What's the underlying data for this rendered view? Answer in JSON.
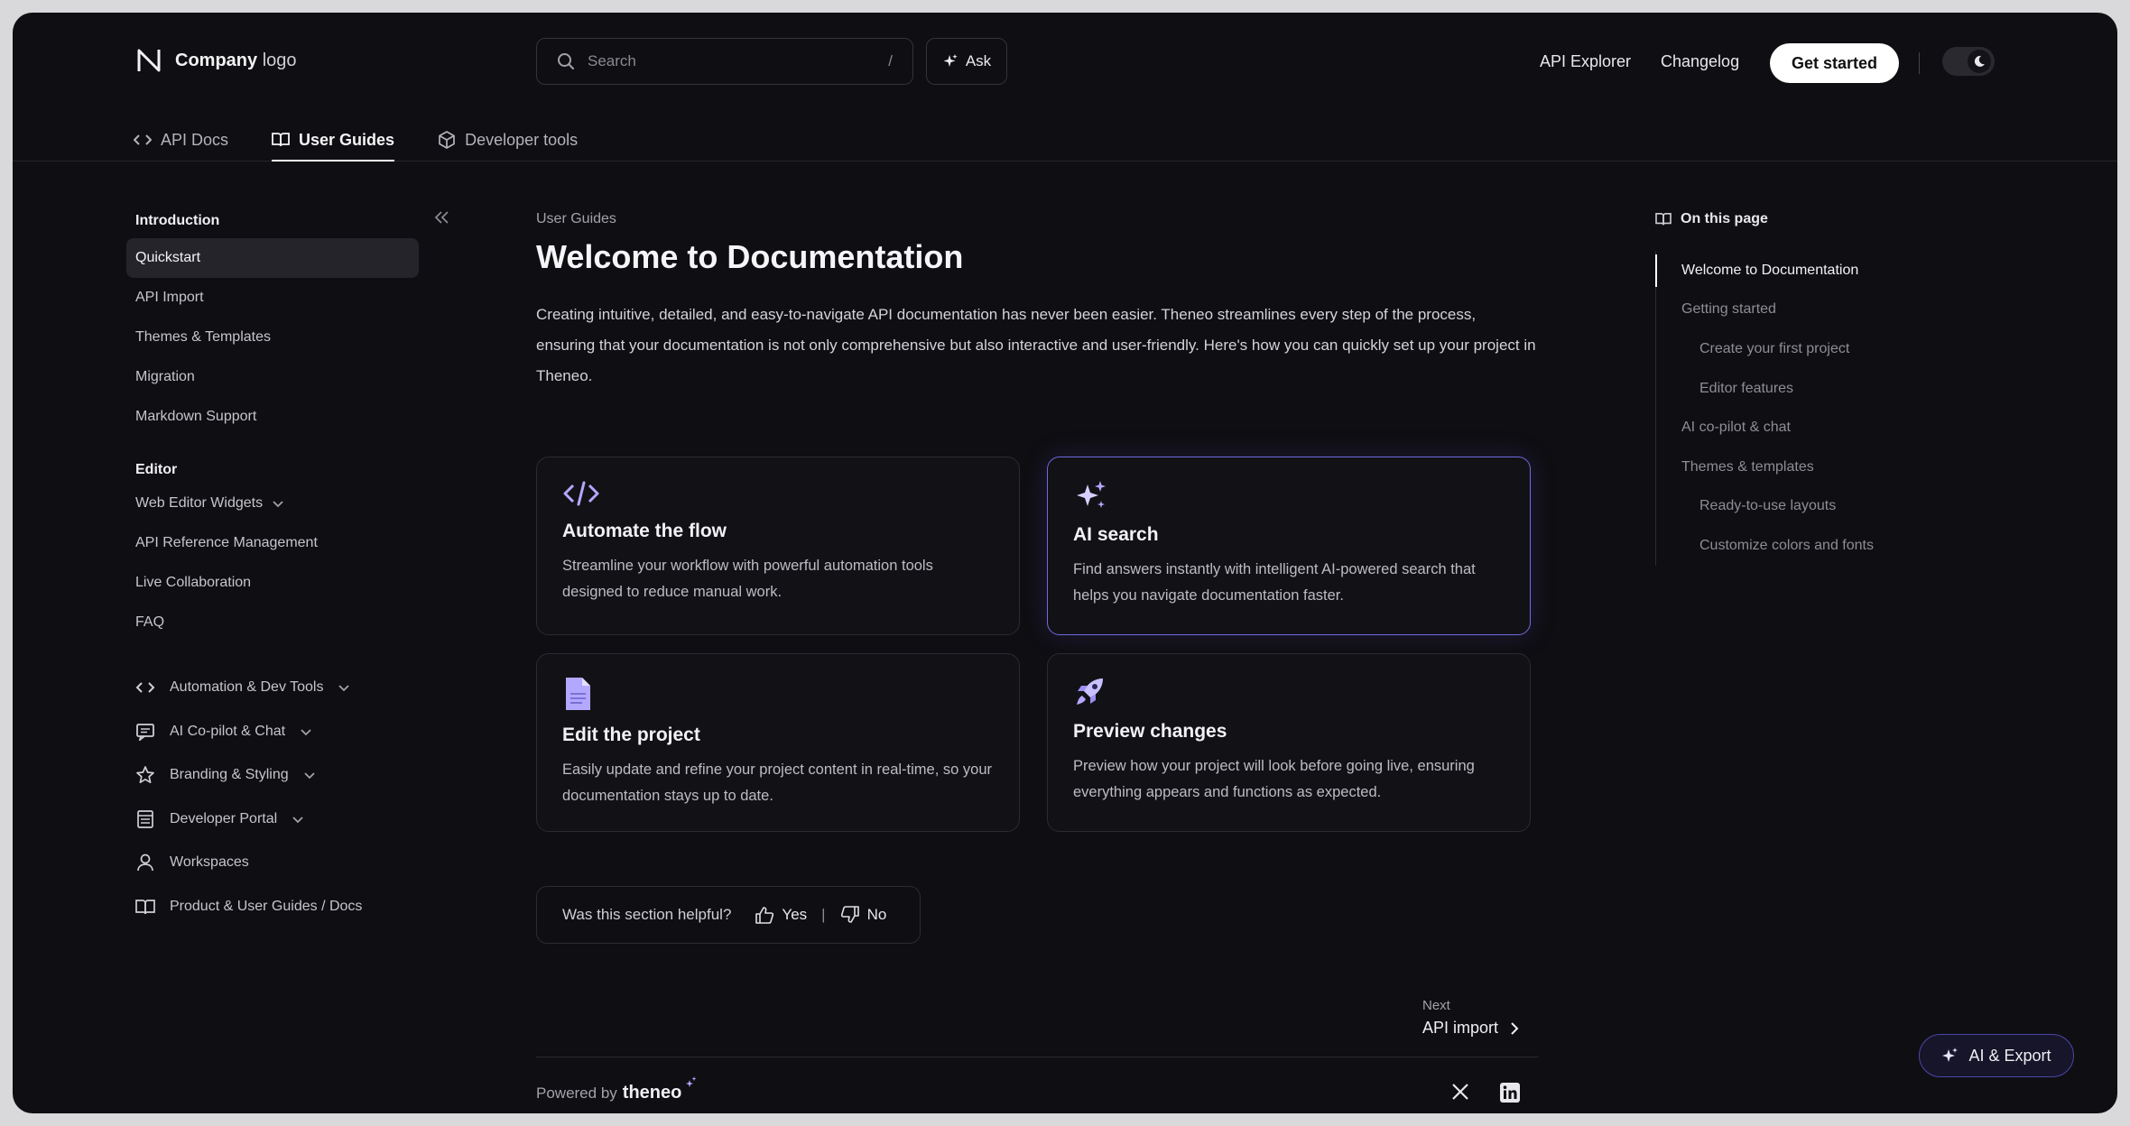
{
  "header": {
    "logo_bold": "Company",
    "logo_light": "logo",
    "search_placeholder": "Search",
    "search_shortcut": "/",
    "ask_label": "Ask",
    "links": [
      "API Explorer",
      "Changelog"
    ],
    "cta_label": "Get started",
    "theme": "dark"
  },
  "tabs": [
    {
      "label": "API Docs",
      "icon": "code-icon",
      "active": false
    },
    {
      "label": "User Guides",
      "icon": "book-icon",
      "active": true
    },
    {
      "label": "Developer tools",
      "icon": "box-icon",
      "active": false
    }
  ],
  "sidebar": {
    "section1": {
      "title": "Introduction",
      "items": [
        "Quickstart",
        "API Import",
        "Themes & Templates",
        "Migration",
        "Markdown Support"
      ],
      "active": "Quickstart"
    },
    "section2": {
      "title": "Editor",
      "items": [
        "Web Editor Widgets",
        "API Reference Management",
        "Live Collaboration",
        "FAQ"
      ]
    },
    "groups": [
      {
        "label": "Automation & Dev Tools",
        "icon": "code-icon",
        "expandable": true
      },
      {
        "label": "AI Co-pilot & Chat",
        "icon": "chat-icon",
        "expandable": true
      },
      {
        "label": "Branding & Styling",
        "icon": "star-icon",
        "expandable": true
      },
      {
        "label": "Developer Portal",
        "icon": "portal-icon",
        "expandable": true
      },
      {
        "label": "Workspaces",
        "icon": "user-icon",
        "expandable": false
      },
      {
        "label": "Product & User Guides / Docs",
        "icon": "book-icon",
        "expandable": false
      }
    ]
  },
  "main": {
    "breadcrumb": "User Guides",
    "title": "Welcome to Documentation",
    "intro": "Creating intuitive, detailed, and easy-to-navigate API documentation has never been easier. Theneo streamlines every step of the process, ensuring that your documentation is not only comprehensive but also interactive and user-friendly. Here's how you can quickly set up your project in Theneo.",
    "cards": [
      {
        "title": "Automate the flow",
        "desc": "Streamline your workflow with powerful automation tools designed to reduce manual work.",
        "icon": "code-icon"
      },
      {
        "title": "AI search",
        "desc": "Find answers instantly with intelligent AI-powered search that helps you navigate documentation faster.",
        "icon": "sparkle-icon"
      },
      {
        "title": "Edit the project",
        "desc": "Easily update and refine your project content in real-time, so your documentation stays up to date.",
        "icon": "document-icon"
      },
      {
        "title": "Preview changes",
        "desc": "Preview how your project will look before going live, ensuring everything appears and functions as expected.",
        "icon": "rocket-icon"
      }
    ],
    "feedback": {
      "question": "Was this section helpful?",
      "yes": "Yes",
      "no": "No"
    },
    "next": {
      "label": "Next",
      "link": "API import"
    },
    "footer": {
      "powered": "Powered by",
      "brand": "theneo"
    }
  },
  "toc": {
    "title": "On this page",
    "items": [
      {
        "label": "Welcome to Documentation",
        "level": 1,
        "active": true
      },
      {
        "label": "Getting started",
        "level": 1
      },
      {
        "label": "Create your first project",
        "level": 2
      },
      {
        "label": "Editor features",
        "level": 2
      },
      {
        "label": "AI co-pilot & chat",
        "level": 1
      },
      {
        "label": "Themes & templates",
        "level": 1
      },
      {
        "label": "Ready-to-use layouts",
        "level": 2
      },
      {
        "label": "Customize colors and fonts",
        "level": 2
      }
    ]
  },
  "ai_export_label": "AI & Export",
  "colors": {
    "background": "#0f0e12",
    "accent": "#6f6ae0",
    "icon_purple": "#b3a8ff"
  }
}
